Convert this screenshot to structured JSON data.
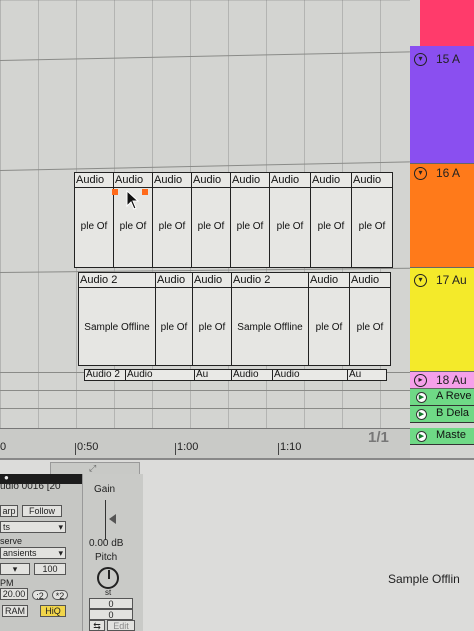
{
  "colors": {
    "track15": "#8a4ff0",
    "track16": "#ff7a1a",
    "track17": "#f4ea2a",
    "track18": "#f5a0ea",
    "returns": "#6fd986",
    "top_track": "#ff3b6b"
  },
  "tracks": [
    {
      "name": "15 A",
      "icon": "chevron-down-icon"
    },
    {
      "name": "16 A",
      "icon": "chevron-down-icon"
    },
    {
      "name": "17 Au",
      "icon": "chevron-down-icon"
    },
    {
      "name": "18 Au",
      "icon": "chevron-right-icon"
    }
  ],
  "returns": [
    {
      "name": "A Reve",
      "icon": "play-icon"
    },
    {
      "name": "B Dela",
      "icon": "play-icon"
    },
    {
      "name": "Maste",
      "icon": "play-icon"
    }
  ],
  "lane16": {
    "headers": [
      "Audio",
      "Audio",
      "Audio",
      "Audio",
      "Audio",
      "Audio",
      "Audio",
      "Audio"
    ],
    "bodies": [
      "ple Of",
      "ple Of",
      "ple Of",
      "ple Of",
      "ple Of",
      "ple Of",
      "ple Of",
      "ple Of"
    ]
  },
  "lane17": {
    "headers": [
      "Audio 2",
      "Audio",
      "Audio",
      "Audio 2",
      "Audio",
      "Audio"
    ],
    "bodies": [
      "Sample Offline",
      "ple Of",
      "ple Of",
      "Sample Offline",
      "ple Of",
      "ple Of"
    ]
  },
  "lane18": {
    "headers": [
      "Audio 2",
      "Audio",
      "Au",
      "Audio",
      "Audio",
      "Au"
    ]
  },
  "ruler": {
    "labels": [
      "0",
      "0:50",
      "1:00",
      "1:10"
    ],
    "page": "1/1"
  },
  "device": {
    "clip_name": "udio 0016 [20",
    "warp": "arp",
    "follow": "Follow",
    "sig": "ts",
    "preserve": "serve",
    "mode": "ansients",
    "num": "100",
    "bpm_label": "PM",
    "bpm": "20.00",
    "half": ":2",
    "double": "*2",
    "ram": "RAM",
    "hiq": "HiQ"
  },
  "gain": {
    "label": "Gain",
    "db": "0.00 dB",
    "pitch_label": "Pitch",
    "st": "st",
    "st_val": "0",
    "cents": "0",
    "edit": "Edit"
  },
  "sample": {
    "label": "Sample Offlin"
  }
}
